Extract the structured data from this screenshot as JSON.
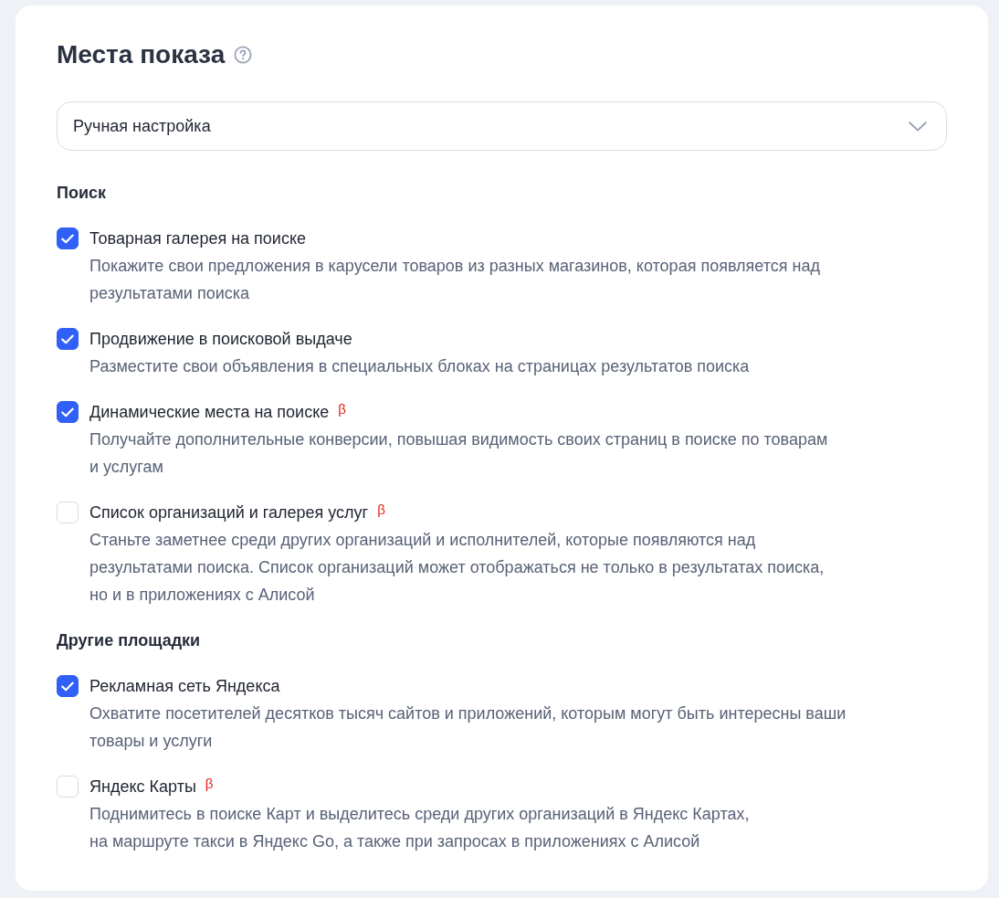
{
  "section": {
    "title": "Места показа"
  },
  "mode_select": {
    "value": "Ручная настройка"
  },
  "groups": [
    {
      "title": "Поиск",
      "options": [
        {
          "label": "Товарная галерея на поиске",
          "description": "Покажите свои предложения в карусели товаров из разных магазинов, которая появляется над\nрезультатами поиска",
          "checked": true
        },
        {
          "label": "Продвижение в поисковой выдаче",
          "description": "Разместите свои объявления в специальных блоках на страницах результатов поиска",
          "checked": true
        },
        {
          "label": "Динамические места на поиске",
          "badge": "β",
          "description": "Получайте дополнительные конверсии, повышая видимость своих страниц в поиске по товарам\nи услугам",
          "checked": true
        },
        {
          "label": "Список организаций и галерея услуг",
          "badge": "β",
          "description": "Станьте заметнее среди других организаций и исполнителей, которые появляются над\nрезультатами поиска. Список организаций может отображаться не только в результатах поиска,\nно и в приложениях с Алисой",
          "checked": false
        }
      ]
    },
    {
      "title": "Другие площадки",
      "options": [
        {
          "label": "Рекламная сеть Яндекса",
          "description": "Охватите посетителей десятков тысяч сайтов и приложений, которым могут быть интересны ваши\nтовары и услуги",
          "checked": true
        },
        {
          "label": "Яндекс Карты",
          "badge": "β",
          "description": "Поднимитесь в поиске Карт и выделитесь среди других организаций в Яндекс Картах,\nна маршруте такси в Яндекс Go, а также при запросах в приложениях с Алисой",
          "checked": false
        }
      ]
    }
  ]
}
